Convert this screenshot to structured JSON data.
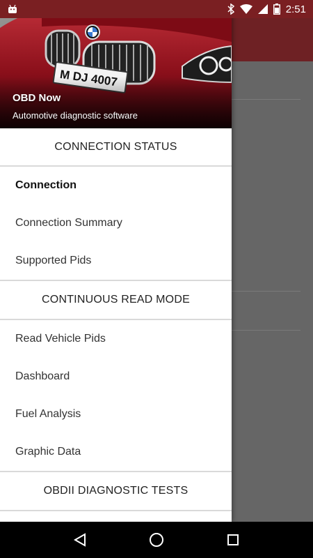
{
  "status_bar": {
    "time": "2:51",
    "icons": [
      "android-icon",
      "bluetooth-icon",
      "wifi-icon",
      "signal-icon",
      "battery-icon"
    ]
  },
  "drawer": {
    "header": {
      "title": "OBD Now",
      "subtitle": "Automotive diagnostic software",
      "plate": "M DJ 4007"
    },
    "sections": [
      {
        "title": "CONNECTION STATUS",
        "items": [
          "Connection",
          "Connection Summary",
          "Supported Pids"
        ]
      },
      {
        "title": "CONTINUOUS READ MODE",
        "items": [
          "Read Vehicle Pids",
          "Dashboard",
          "Fuel Analysis",
          "Graphic Data"
        ]
      },
      {
        "title": "OBDII DIAGNOSTIC TESTS",
        "items": []
      }
    ],
    "selected_item": "Connection"
  },
  "nav_bar": {
    "icons": [
      "back-icon",
      "home-icon",
      "recents-icon"
    ]
  },
  "colors": {
    "toolbar": "#6e2124",
    "status_bar": "#7a1f22",
    "scrim": "#666666",
    "drawer_bg": "#ffffff"
  }
}
